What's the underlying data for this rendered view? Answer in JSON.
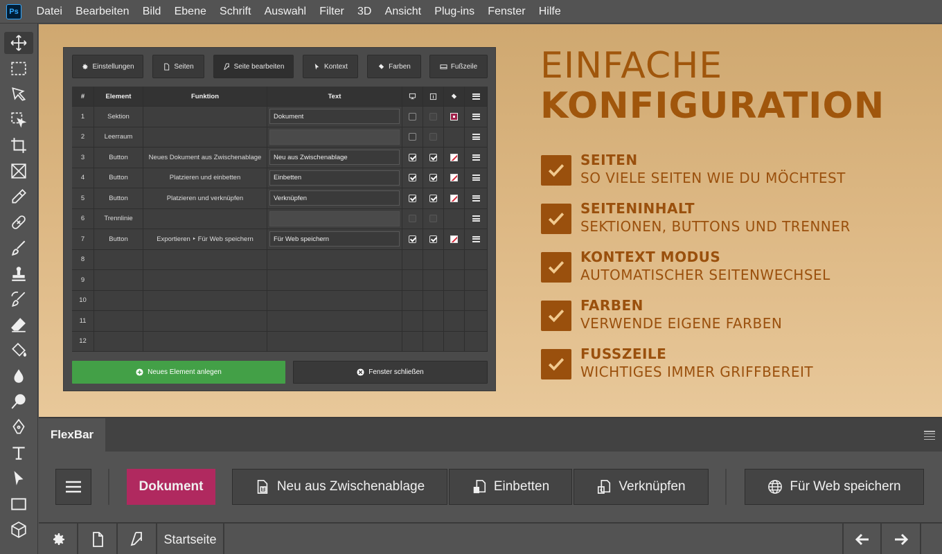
{
  "app": {
    "logo": "Ps"
  },
  "menubar": [
    "Datei",
    "Bearbeiten",
    "Bild",
    "Ebene",
    "Schrift",
    "Auswahl",
    "Filter",
    "3D",
    "Ansicht",
    "Plug-ins",
    "Fenster",
    "Hilfe"
  ],
  "tools": [
    "move-tool-icon",
    "marquee-tool-icon",
    "lasso-tool-icon",
    "object-select-tool-icon",
    "crop-tool-icon",
    "frame-tool-icon",
    "eyedropper-tool-icon",
    "healing-brush-icon",
    "brush-tool-icon",
    "stamp-tool-icon",
    "history-brush-icon",
    "eraser-tool-icon",
    "paint-bucket-icon",
    "blur-tool-icon",
    "dodge-tool-icon",
    "pen-tool-icon",
    "type-tool-icon",
    "path-select-icon",
    "rectangle-tool-icon",
    "3d-tool-icon"
  ],
  "config": {
    "tabs": [
      {
        "label": "Einstellungen",
        "icon": "gear-icon"
      },
      {
        "label": "Seiten",
        "icon": "page-icon"
      },
      {
        "label": "Seite bearbeiten",
        "icon": "page-edit-icon"
      },
      {
        "label": "Kontext",
        "icon": "cursor-icon"
      },
      {
        "label": "Farben",
        "icon": "paint-bucket-icon"
      },
      {
        "label": "Fußzeile",
        "icon": "footer-icon"
      }
    ],
    "columns": {
      "num": "#",
      "element": "Element",
      "function": "Funktion",
      "text": "Text"
    },
    "rows": [
      {
        "num": "1",
        "element": "Sektion",
        "function": "",
        "text": "Dokument",
        "c1": "off",
        "c2": "dim",
        "color": "magenta"
      },
      {
        "num": "2",
        "element": "Leerraum",
        "function": "",
        "text": "",
        "c1": "off",
        "c2": "dim",
        "color": ""
      },
      {
        "num": "3",
        "element": "Button",
        "function": "Neues Dokument aus Zwischenablage",
        "text": "Neu aus Zwischenablage",
        "c1": "on",
        "c2": "on",
        "color": "nocolor"
      },
      {
        "num": "4",
        "element": "Button",
        "function": "Platzieren und einbetten",
        "text": "Einbetten",
        "c1": "on",
        "c2": "on",
        "color": "nocolor"
      },
      {
        "num": "5",
        "element": "Button",
        "function": "Platzieren und verknüpfen",
        "text": "Verknüpfen",
        "c1": "on",
        "c2": "on",
        "color": "nocolor"
      },
      {
        "num": "6",
        "element": "Trennlinie",
        "function": "",
        "text": "",
        "c1": "dim",
        "c2": "dim",
        "color": ""
      },
      {
        "num": "7",
        "element": "Button",
        "function": "Exportieren ‣ Für Web speichern",
        "text": "Für Web speichern",
        "c1": "on",
        "c2": "on",
        "color": "nocolor"
      },
      {
        "num": "8"
      },
      {
        "num": "9"
      },
      {
        "num": "10"
      },
      {
        "num": "11"
      },
      {
        "num": "12"
      }
    ],
    "add_button": "Neues Element anlegen",
    "close_button": "Fenster schließen",
    "colors": {
      "add": "#43a047",
      "accent": "#b0295f"
    }
  },
  "features": {
    "title_line1": "EINFACHE",
    "title_line2": "KONFIGURATION",
    "color": "#9a500d",
    "items": [
      {
        "head": "SEITEN",
        "sub": "SO VIELE SEITEN WIE DU MÖCHTEST"
      },
      {
        "head": "SEITENINHALT",
        "sub": "SEKTIONEN, BUTTONS UND TRENNER"
      },
      {
        "head": "KONTEXT MODUS",
        "sub": "AUTOMATISCHER SEITENWECHSEL"
      },
      {
        "head": "FARBEN",
        "sub": "VERWENDE EIGENE FARBEN"
      },
      {
        "head": "FUSSZEILE",
        "sub": "WICHTIGES IMMER GRIFFBEREIT"
      }
    ]
  },
  "flexbar": {
    "tab": "FlexBar",
    "buttons": {
      "section": "Dokument",
      "new_clipboard": "Neu aus Zwischenablage",
      "embed": "Einbetten",
      "link": "Verknüpfen",
      "save_web": "Für Web speichern"
    },
    "footer": {
      "page": "Startseite"
    }
  }
}
